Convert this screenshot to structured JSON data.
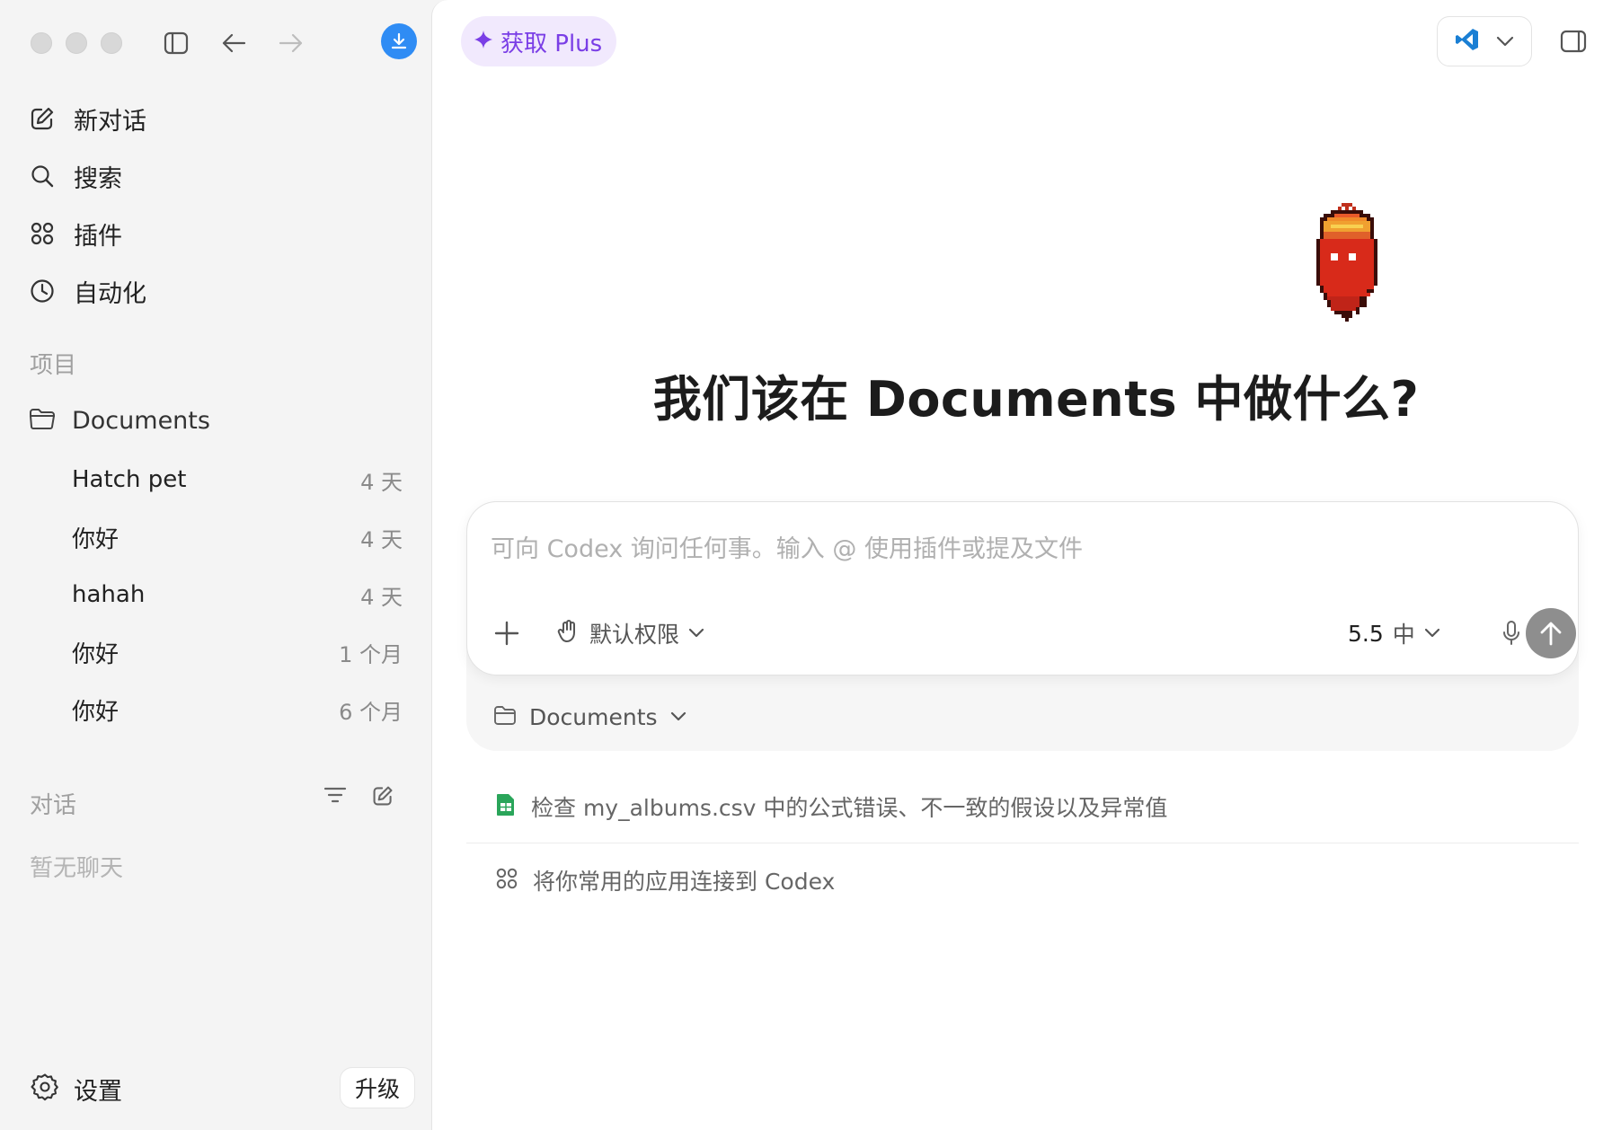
{
  "sidebar": {
    "nav": [
      {
        "id": "new-chat",
        "label": "新对话",
        "icon": "compose-icon"
      },
      {
        "id": "search",
        "label": "搜索",
        "icon": "search-icon"
      },
      {
        "id": "plugins",
        "label": "插件",
        "icon": "grid-icon"
      },
      {
        "id": "automation",
        "label": "自动化",
        "icon": "clock-icon"
      }
    ],
    "projects_title": "项目",
    "project": {
      "label": "Documents",
      "icon": "folder-icon"
    },
    "threads": [
      {
        "title": "Hatch pet",
        "age": "4 天"
      },
      {
        "title": "你好",
        "age": "4 天"
      },
      {
        "title": "hahah",
        "age": "4 天"
      },
      {
        "title": "你好",
        "age": "1 个月"
      },
      {
        "title": "你好",
        "age": "6 个月"
      }
    ],
    "conversations_title": "对话",
    "empty_text": "暂无聊天",
    "settings_label": "设置",
    "upgrade_label": "升级"
  },
  "main": {
    "plus_label": "获取 Plus",
    "headline": "我们该在 Documents 中做什么?",
    "composer": {
      "placeholder": "可向 Codex 询问任何事。输入 @ 使用插件或提及文件",
      "permission_label": "默认权限",
      "model_version": "5.5",
      "model_effort": "中"
    },
    "folder_label": "Documents",
    "suggestions": [
      {
        "label": "检查 my_albums.csv 中的公式错误、不一致的假设以及异常值",
        "icon": "spreadsheet-icon"
      },
      {
        "label": "将你常用的应用连接到 Codex",
        "icon": "grid-icon"
      }
    ]
  },
  "colors": {
    "accent_blue": "#2f8cf4",
    "plus_purple": "#7a3ee6",
    "plus_bg": "#f1e9fd",
    "sidebar_bg": "#f4f4f4",
    "send_gray": "#8e8e8e"
  }
}
